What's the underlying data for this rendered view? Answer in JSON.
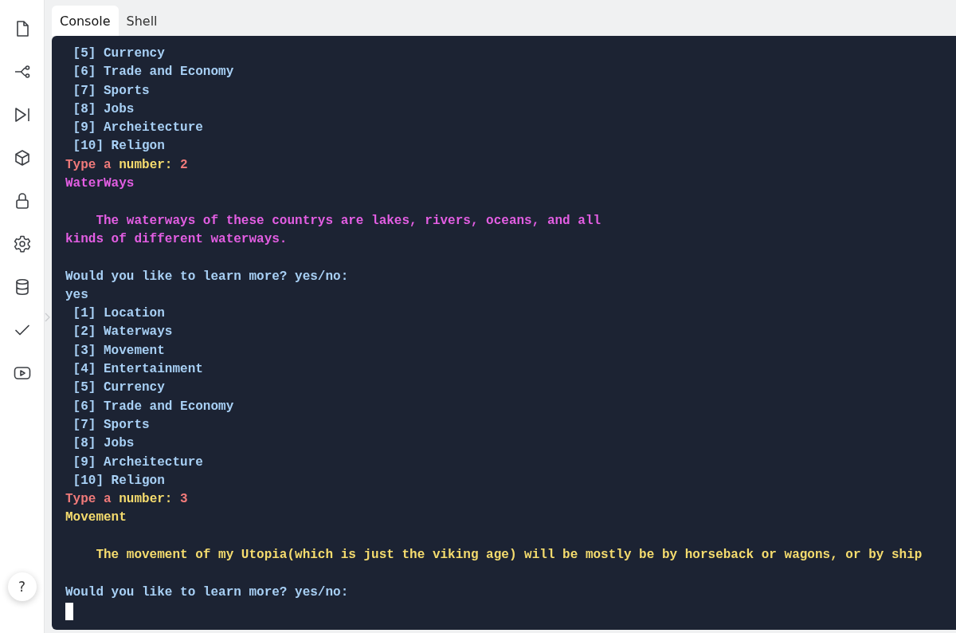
{
  "sidebar": {
    "icons": [
      {
        "kind": "file"
      },
      {
        "kind": "branch"
      },
      {
        "kind": "step"
      },
      {
        "kind": "cube"
      },
      {
        "kind": "lock"
      },
      {
        "kind": "gear"
      },
      {
        "kind": "database"
      },
      {
        "kind": "check"
      },
      {
        "kind": "video"
      }
    ],
    "help": "?"
  },
  "tabs": [
    {
      "label": "Console",
      "selected": true
    },
    {
      "label": "Shell",
      "selected": false
    }
  ],
  "console": {
    "lines": [
      {
        "kind": "text",
        "segments": [
          {
            "text": " [5] Currency",
            "color": "#a8d0f5"
          }
        ]
      },
      {
        "kind": "text",
        "segments": [
          {
            "text": " [6] Trade and Economy",
            "color": "#a8d0f5"
          }
        ]
      },
      {
        "kind": "text",
        "segments": [
          {
            "text": " [7] Sports",
            "color": "#a8d0f5"
          }
        ]
      },
      {
        "kind": "text",
        "segments": [
          {
            "text": " [8] Jobs",
            "color": "#a8d0f5"
          }
        ]
      },
      {
        "kind": "text",
        "segments": [
          {
            "text": " [9] Archeitecture",
            "color": "#a8d0f5"
          }
        ]
      },
      {
        "kind": "text",
        "segments": [
          {
            "text": " [10] Religon",
            "color": "#a8d0f5"
          }
        ]
      },
      {
        "kind": "text",
        "segments": [
          {
            "text": "Type a ",
            "color": "#f07a7a"
          },
          {
            "text": "number: ",
            "color": "#f5dc6e"
          },
          {
            "text": "2",
            "color": "#f07a7a"
          }
        ]
      },
      {
        "kind": "text",
        "segments": [
          {
            "text": "WaterWays",
            "color": "#e35ee3"
          }
        ]
      },
      {
        "kind": "blank"
      },
      {
        "kind": "text",
        "segments": [
          {
            "text": "    The waterways of these countrys are lakes, rivers, oceans, and all",
            "color": "#e35ee3"
          }
        ]
      },
      {
        "kind": "text",
        "segments": [
          {
            "text": "kinds of different waterways.",
            "color": "#e35ee3"
          }
        ]
      },
      {
        "kind": "blank"
      },
      {
        "kind": "text",
        "segments": [
          {
            "text": "Would you like to learn more? yes/no:",
            "color": "#a8d0f5"
          }
        ]
      },
      {
        "kind": "text",
        "segments": [
          {
            "text": "yes",
            "color": "#a8d0f5"
          }
        ]
      },
      {
        "kind": "text",
        "segments": [
          {
            "text": " [1] Location",
            "color": "#a8d0f5"
          }
        ]
      },
      {
        "kind": "text",
        "segments": [
          {
            "text": " [2] Waterways",
            "color": "#a8d0f5"
          }
        ]
      },
      {
        "kind": "text",
        "segments": [
          {
            "text": " [3] Movement",
            "color": "#a8d0f5"
          }
        ]
      },
      {
        "kind": "text",
        "segments": [
          {
            "text": " [4] Entertainment",
            "color": "#a8d0f5"
          }
        ]
      },
      {
        "kind": "text",
        "segments": [
          {
            "text": " [5] Currency",
            "color": "#a8d0f5"
          }
        ]
      },
      {
        "kind": "text",
        "segments": [
          {
            "text": " [6] Trade and Economy",
            "color": "#a8d0f5"
          }
        ]
      },
      {
        "kind": "text",
        "segments": [
          {
            "text": " [7] Sports",
            "color": "#a8d0f5"
          }
        ]
      },
      {
        "kind": "text",
        "segments": [
          {
            "text": " [8] Jobs",
            "color": "#a8d0f5"
          }
        ]
      },
      {
        "kind": "text",
        "segments": [
          {
            "text": " [9] Archeitecture",
            "color": "#a8d0f5"
          }
        ]
      },
      {
        "kind": "text",
        "segments": [
          {
            "text": " [10] Religon",
            "color": "#a8d0f5"
          }
        ]
      },
      {
        "kind": "text",
        "segments": [
          {
            "text": "Type a ",
            "color": "#f07a7a"
          },
          {
            "text": "number: ",
            "color": "#f5dc6e"
          },
          {
            "text": "3",
            "color": "#f07a7a"
          }
        ]
      },
      {
        "kind": "text",
        "segments": [
          {
            "text": "Movement",
            "color": "#f5dc6e"
          }
        ]
      },
      {
        "kind": "blank"
      },
      {
        "kind": "text",
        "segments": [
          {
            "text": "    The movement of my Utopia(which is just the viking age) will be mostly be by horseback or wagons, or by ship",
            "color": "#f5dc6e"
          }
        ]
      },
      {
        "kind": "blank"
      },
      {
        "kind": "text",
        "segments": [
          {
            "text": "Would you like to learn more? yes/no:",
            "color": "#a8d0f5"
          }
        ]
      },
      {
        "kind": "cursor"
      }
    ]
  }
}
